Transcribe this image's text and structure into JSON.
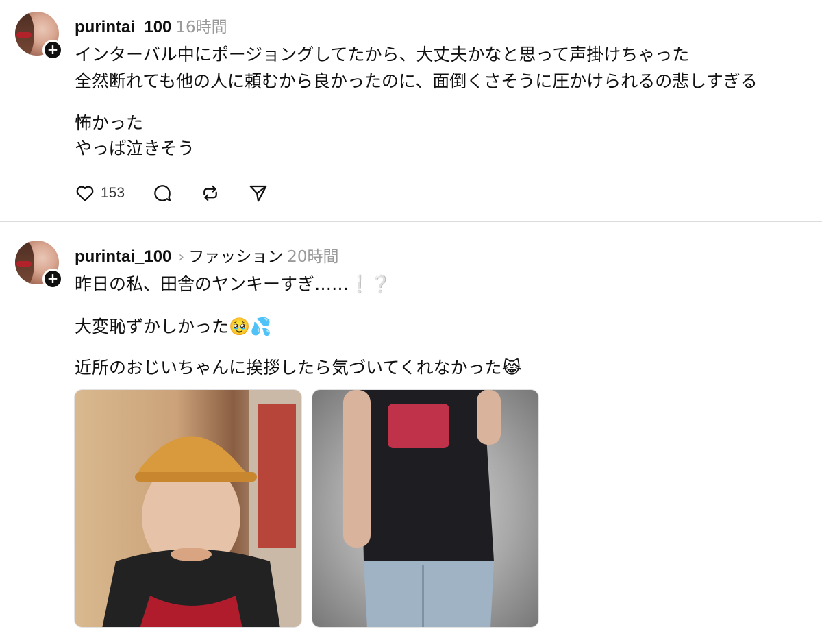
{
  "posts": [
    {
      "username": "purintai_100",
      "time": "16時間",
      "lines": [
        "インターバル中にポージョングしてたから、大丈夫かなと思って声掛けちゃった",
        "全然断れても他の人に頼むから良かったのに、面倒くさそうに圧かけられるの悲しすぎる",
        "怖かった",
        "やっぱ泣きそう"
      ],
      "likes": "153"
    },
    {
      "username": "purintai_100",
      "topic": "ファッション",
      "time": "20時間",
      "lines": [
        "昨日の私、田舎のヤンキーすぎ……❕❔",
        "大変恥ずかしかった🥹💦",
        "近所のおじいちゃんに挨拶したら気づいてくれなかった😹"
      ],
      "images": [
        "selfie-with-cap-photo",
        "outfit-mirror-photo"
      ]
    }
  ],
  "icons": {
    "follow": "plus-icon",
    "like": "heart-icon",
    "comment": "comment-icon",
    "repost": "repost-icon",
    "share": "send-icon"
  },
  "colors": {
    "text": "#101010",
    "muted": "#9a9a9a",
    "divider": "#dcdcdc"
  }
}
